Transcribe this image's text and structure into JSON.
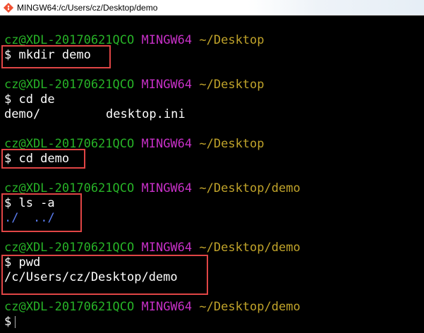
{
  "window": {
    "title": "MINGW64:/c/Users/cz/Desktop/demo"
  },
  "colors": {
    "user": "#27b327",
    "msystem": "#c730c7",
    "path": "#c0a32a",
    "highlight": "#e04545",
    "dir": "#5a7cf0"
  },
  "prompts": [
    {
      "user": "cz@XDL-20170621QCO",
      "msystem": "MINGW64",
      "path": "~/Desktop"
    },
    {
      "user": "cz@XDL-20170621QCO",
      "msystem": "MINGW64",
      "path": "~/Desktop"
    },
    {
      "user": "cz@XDL-20170621QCO",
      "msystem": "MINGW64",
      "path": "~/Desktop"
    },
    {
      "user": "cz@XDL-20170621QCO",
      "msystem": "MINGW64",
      "path": "~/Desktop/demo"
    },
    {
      "user": "cz@XDL-20170621QCO",
      "msystem": "MINGW64",
      "path": "~/Desktop/demo"
    },
    {
      "user": "cz@XDL-20170621QCO",
      "msystem": "MINGW64",
      "path": "~/Desktop/demo"
    }
  ],
  "commands": [
    "$ mkdir demo",
    "$ cd de",
    "$ cd demo",
    "$ ls -a",
    "$ pwd",
    "$"
  ],
  "outputs": {
    "completion": [
      "demo/",
      "desktop.ini"
    ],
    "ls": [
      "./",
      "../"
    ],
    "pwd": "/c/Users/cz/Desktop/demo"
  }
}
